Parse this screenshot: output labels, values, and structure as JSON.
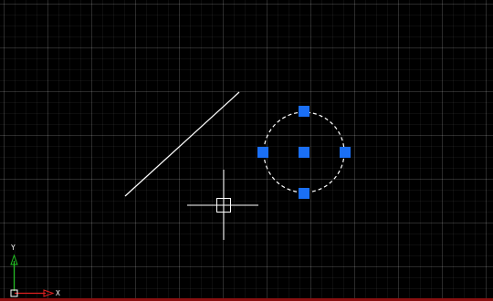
{
  "canvas": {
    "background_color": "#000000",
    "grid_color": "#2a2a2a"
  },
  "entities": {
    "line": {
      "color": "#ffffff"
    },
    "circle": {
      "color": "#ffffff",
      "style": "dashed",
      "selected": true
    },
    "grip_color": "#1a6ff5"
  },
  "cursor": {
    "type": "crosshair-pickbox",
    "color": "#ffffff"
  },
  "ucs": {
    "x_label": "X",
    "y_label": "Y",
    "x_color": "#e02020",
    "y_color": "#22c022"
  }
}
